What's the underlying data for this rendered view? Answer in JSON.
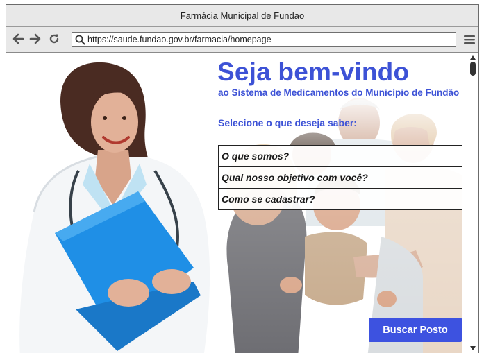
{
  "window": {
    "title": "Farmácia Municipal de Fundao"
  },
  "toolbar": {
    "back_icon": "arrow-left-icon",
    "forward_icon": "arrow-right-icon",
    "reload_icon": "reload-icon",
    "url": "https://saude.fundao.gov.br/farmacia/homepage",
    "menu_icon": "hamburger-menu-icon"
  },
  "hero": {
    "title": "Seja bem-vindo",
    "subtitle": "ao Sistema de Medicamentos do Município de Fundão",
    "prompt": "Selecione o que deseja saber:"
  },
  "faq": {
    "items": [
      "O que somos?",
      "Qual nosso objetivo com você?",
      "Como se cadastrar?"
    ]
  },
  "cta": {
    "label": "Buscar Posto"
  },
  "colors": {
    "accent": "#3d52d6",
    "button": "#3d52e0"
  }
}
